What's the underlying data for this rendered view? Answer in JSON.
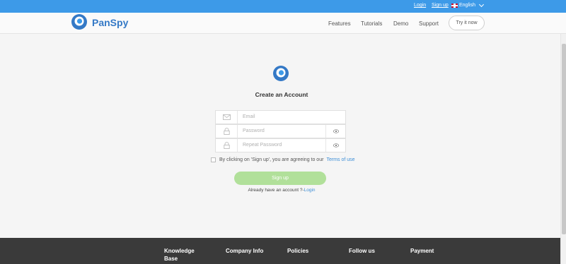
{
  "topbar": {
    "login": "Login",
    "signup": "Sign up",
    "language": "English"
  },
  "header": {
    "brand": "PanSpy",
    "nav": [
      "Features",
      "Tutorials",
      "Demo",
      "Support"
    ],
    "try_button": "Try it now"
  },
  "form": {
    "title": "Create an Account",
    "email_placeholder": "Email",
    "password_placeholder": "Password",
    "repeat_placeholder": "Repeat Password",
    "terms_text": "By clicking on 'Sign up', you are agreeing to our",
    "terms_link": "Terms of use",
    "signup_button": "Sign up",
    "have_account": "Already have an account ?-",
    "login_link": "Login"
  },
  "footer": {
    "columns": [
      "Knowledge Base",
      "Company Info",
      "Policies",
      "Follow us",
      "Payment"
    ]
  },
  "colors": {
    "accent": "#3d9ae8",
    "brand": "#3479c6",
    "signup": "#b1e09a",
    "footer": "#3a3a3a"
  }
}
